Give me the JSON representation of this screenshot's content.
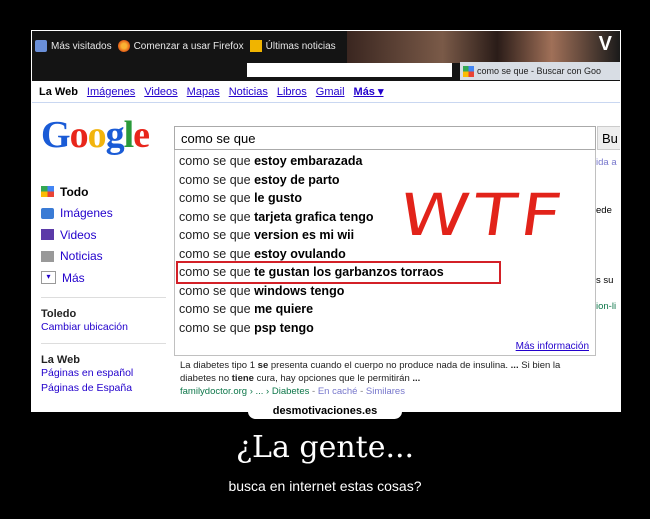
{
  "browser": {
    "bookmarks": [
      "Más visitados",
      "Comenzar a usar Firefox",
      "Últimas noticias"
    ],
    "tab_title": "como se que - Buscar con Goo"
  },
  "google": {
    "nav": {
      "active": "La Web",
      "links": [
        "Imágenes",
        "Videos",
        "Mapas",
        "Noticias",
        "Libros",
        "Gmail",
        "Más ▾"
      ]
    },
    "logo": "Google",
    "search_value": "como se que",
    "search_button": "Bu",
    "suggestions": [
      {
        "prefix": "como se que",
        "bold": "estoy embarazada"
      },
      {
        "prefix": "como se que",
        "bold": "estoy de parto"
      },
      {
        "prefix": "como se que",
        "bold": "le gusto"
      },
      {
        "prefix": "como se que",
        "bold": "tarjeta grafica tengo"
      },
      {
        "prefix": "como se que",
        "bold": "version es mi wii"
      },
      {
        "prefix": "como se que",
        "bold": "estoy ovulando"
      },
      {
        "prefix": "como se que",
        "bold": "te gustan los garbanzos torraos"
      },
      {
        "prefix": "como se que",
        "bold": "windows tengo"
      },
      {
        "prefix": "como se que",
        "bold": "me quiere"
      },
      {
        "prefix": "como se que",
        "bold": "psp tengo"
      }
    ],
    "highlighted_index": 6,
    "more_info": "Más información",
    "annotation": "WTF",
    "sidebar": {
      "items": [
        "Todo",
        "Imágenes",
        "Videos",
        "Noticias",
        "Más"
      ],
      "location_title": "Toledo",
      "location_link": "Cambiar ubicación",
      "web_title": "La Web",
      "web_links": [
        "Páginas en español",
        "Páginas de España"
      ]
    },
    "right_fragments": [
      "ida a",
      "ede",
      "s su",
      "ion-li",
      "Si bien la"
    ],
    "result": {
      "line1_start": "La diabetes tipo 1",
      "line1_bold": "se",
      "line1_rest": "presenta cuando el cuerpo no produce nada de insulina.",
      "line1_end": "...",
      "line2_start": "diabetes no",
      "line2_bold": "tiene",
      "line2_rest": "cura, hay opciones que le permitirán",
      "line2_end": "...",
      "cite": "familydoctor.org › ... › Diabetes",
      "cached": "En caché",
      "similar": "Similares"
    }
  },
  "poster": {
    "brand": "desmotivaciones.es",
    "title": "¿La gente...",
    "subtitle": "busca en internet estas cosas?"
  },
  "colors": {
    "accent_red": "#e2231a",
    "link_blue": "#2200cc",
    "cite_green": "#0e774a"
  }
}
